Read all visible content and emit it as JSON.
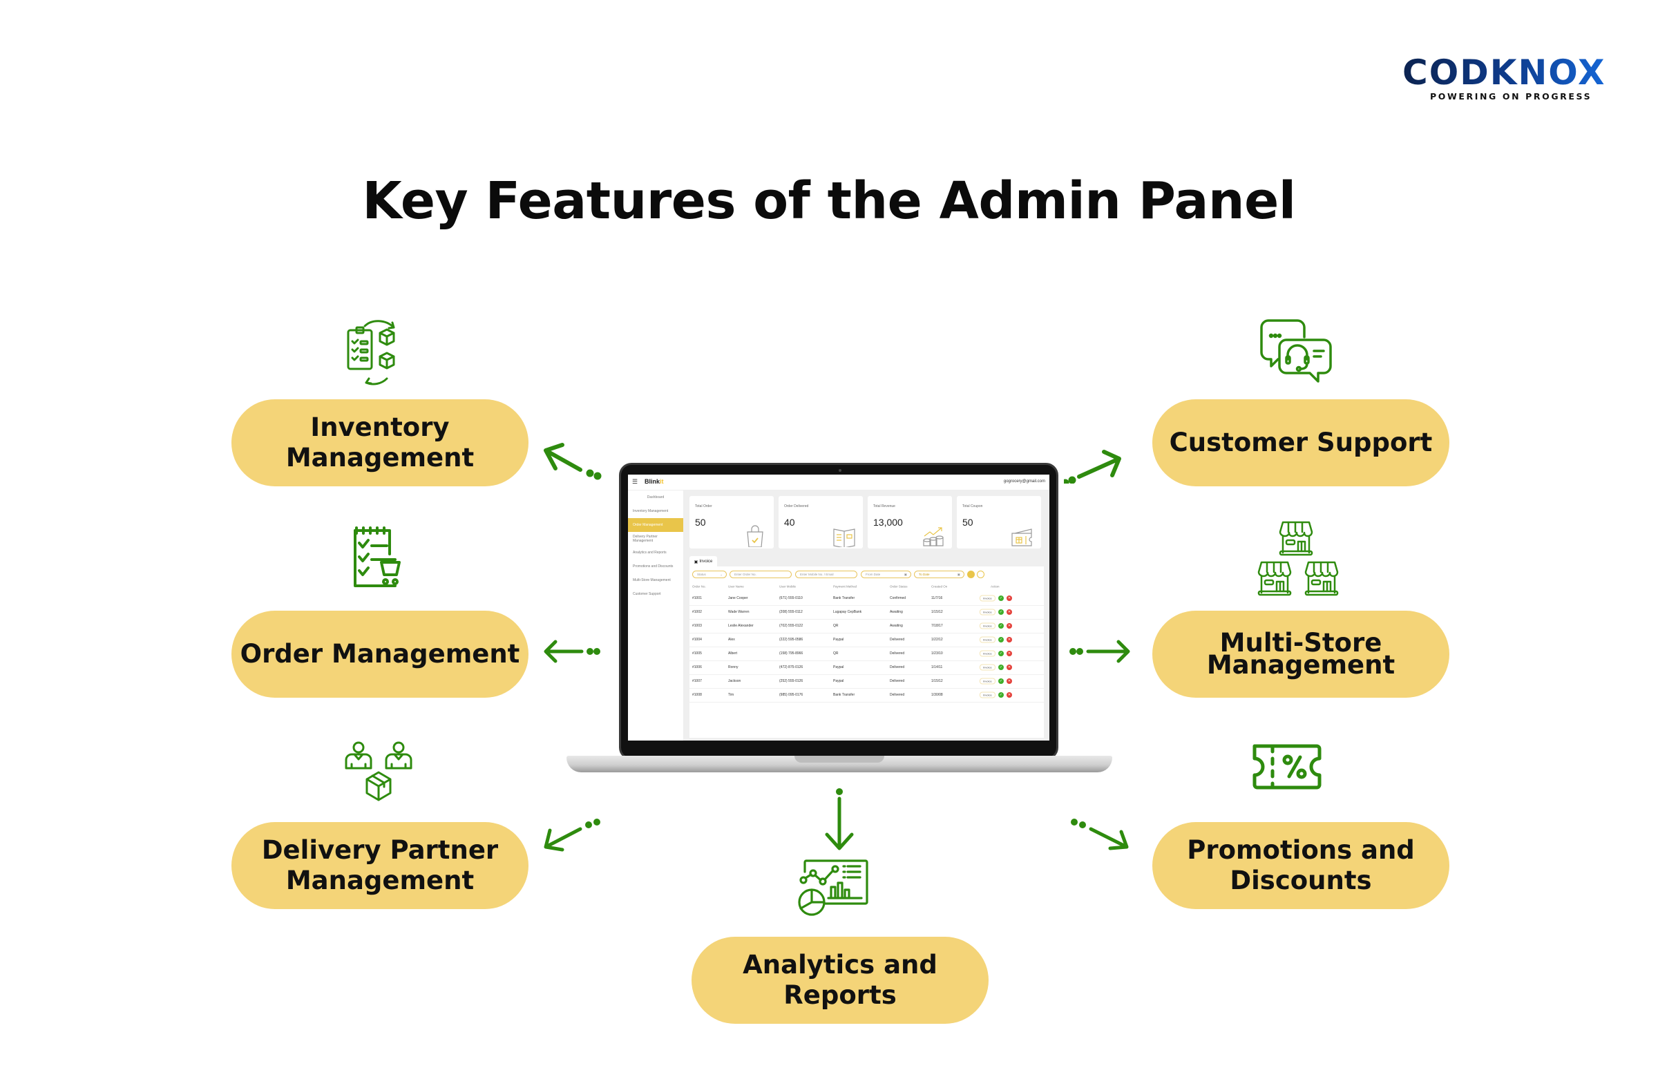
{
  "logo": {
    "wordmark": "CODKNOX",
    "tagline": "POWERING ON PROGRESS"
  },
  "title": "Key Features of the Admin Panel",
  "colors": {
    "pill": "#f4d478",
    "icon_green": "#2e8b0e",
    "arrow_green": "#2e8b0e",
    "laptop_accent": "#e9c54a"
  },
  "features": [
    {
      "label": "Inventory\nManagement",
      "icon": "inventory-icon"
    },
    {
      "label": "Order Management",
      "icon": "order-cart-icon"
    },
    {
      "label": "Delivery Partner\nManagement",
      "icon": "delivery-partner-icon"
    },
    {
      "label": "Customer Support",
      "icon": "customer-support-icon"
    },
    {
      "label": "Multi-Store\nManagement",
      "icon": "multi-store-icon"
    },
    {
      "label": "Promotions and\nDiscounts",
      "icon": "coupon-percent-icon"
    },
    {
      "label": "Analytics and\nReports",
      "icon": "analytics-icon"
    }
  ],
  "dashboard": {
    "brand_pre": "Blink",
    "brand_accent": "it",
    "email": "gogrocery@gmail.com",
    "sidebar": [
      "Dashboard",
      "Inventory Management",
      "Order Management",
      "Delivery Partner Management",
      "Analytics and Reports",
      "Promotions and Discounts",
      "Multi-Store Management",
      "Customer Support"
    ],
    "active_sidebar": "Order Management",
    "cards": [
      {
        "label": "Total Order",
        "value": "50",
        "icon": "shopping-bag-icon"
      },
      {
        "label": "Order Delivered",
        "value": "40",
        "icon": "open-book-icon"
      },
      {
        "label": "Total Revenue",
        "value": "13,000",
        "icon": "coins-growth-icon"
      },
      {
        "label": "Total Coupon",
        "value": "50",
        "icon": "gift-coupon-icon"
      }
    ],
    "tab": "Invoice",
    "filters": {
      "status": "Status",
      "order_no": "Enter Order No.",
      "mobile": "Enter Mobile No. / Email",
      "from_date": "From Date",
      "to_date": "To Date"
    },
    "columns": [
      "Order No.",
      "User Name",
      "User Mobile",
      "Payment Method",
      "Order Status",
      "Created On",
      "Action"
    ],
    "invoice_label": "Invoice",
    "rows": [
      [
        "#1001",
        "Jane Cooper",
        "(671) 555-0110",
        "Bank Transfer",
        "Confirmed",
        "11/7/16"
      ],
      [
        "#1002",
        "Wade Warren",
        "(208) 555-0112",
        "Lugapay CepBank",
        "Awaiting",
        "1/15/12"
      ],
      [
        "#1003",
        "Leslie Alexander",
        "(702) 555-0122",
        "QR",
        "Awaiting",
        "7/18/17"
      ],
      [
        "#1004",
        "Alex",
        "(222) 595-0586",
        "Paypal",
        "Delivered",
        "1/22/12"
      ],
      [
        "#1005",
        "Albert",
        "(158) 795-8966",
        "QR",
        "Delivered",
        "1/23/10"
      ],
      [
        "#1006",
        "Ronny",
        "(472) 875-0126",
        "Paypal",
        "Delivered",
        "1/14/11"
      ],
      [
        "#1007",
        "Jackson",
        "(252) 555-0126",
        "Paypal",
        "Delivered",
        "1/15/12"
      ],
      [
        "#1008",
        "Tim",
        "(985) 095-0176",
        "Bank Transfer",
        "Delivered",
        "1/30/08"
      ]
    ]
  }
}
